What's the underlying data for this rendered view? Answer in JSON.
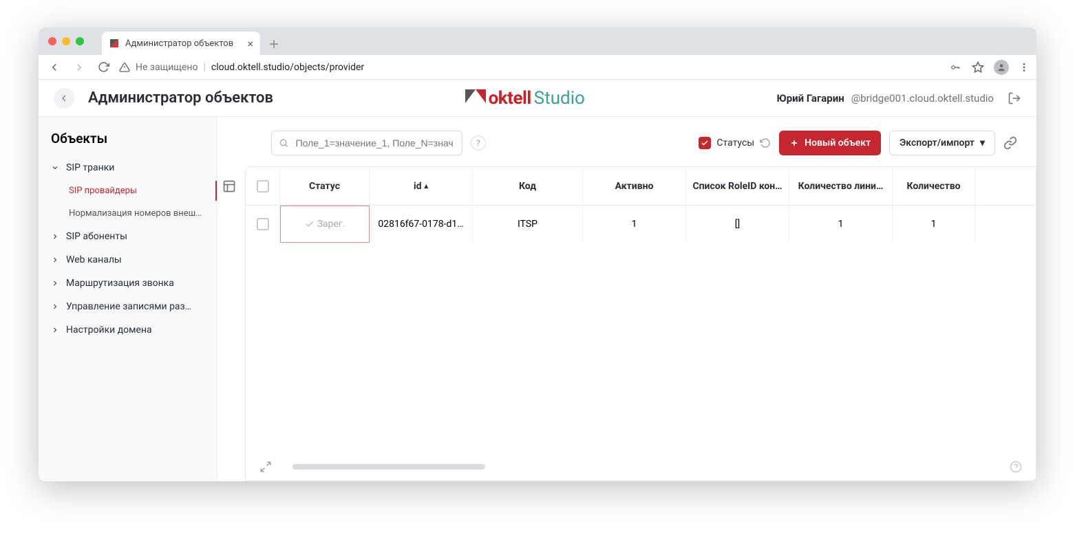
{
  "browser": {
    "tab_title": "Администратор объектов",
    "security_label": "Не защищено",
    "url": "cloud.oktell.studio/objects/provider"
  },
  "header": {
    "page_title": "Администратор объектов",
    "logo_oktell": "oktell",
    "logo_studio": "Studio",
    "user_name": "Юрий Гагарин",
    "user_at": "@bridge001.cloud.oktell.studio"
  },
  "sidebar": {
    "title": "Объекты",
    "items": [
      {
        "label": "SIP транки",
        "expanded": true
      },
      {
        "label": "SIP провайдеры",
        "child": true,
        "active": true
      },
      {
        "label": "Нормализация номеров внеш…",
        "child": true
      },
      {
        "label": "SIP абоненты"
      },
      {
        "label": "Web каналы"
      },
      {
        "label": "Маршрутизация звонка"
      },
      {
        "label": "Управление записями раз…"
      },
      {
        "label": "Настройки домена"
      }
    ]
  },
  "toolbar": {
    "search_placeholder": "Поле_1=значение_1, Поле_N=знач…",
    "statuses_label": "Статусы",
    "new_label": "Новый объект",
    "export_label": "Экспорт/импорт"
  },
  "table": {
    "headers": [
      "",
      "Статус",
      "id",
      "Код",
      "Активно",
      "Список RoleID кон…",
      "Количество лини…",
      "Количество "
    ],
    "sort_col": "id",
    "rows": [
      {
        "status": "Зарег.",
        "id": "02816f67-0178-d1…",
        "code": "ITSP",
        "active": "1",
        "roles": "[]",
        "lines": "1",
        "count2": "1"
      }
    ]
  }
}
